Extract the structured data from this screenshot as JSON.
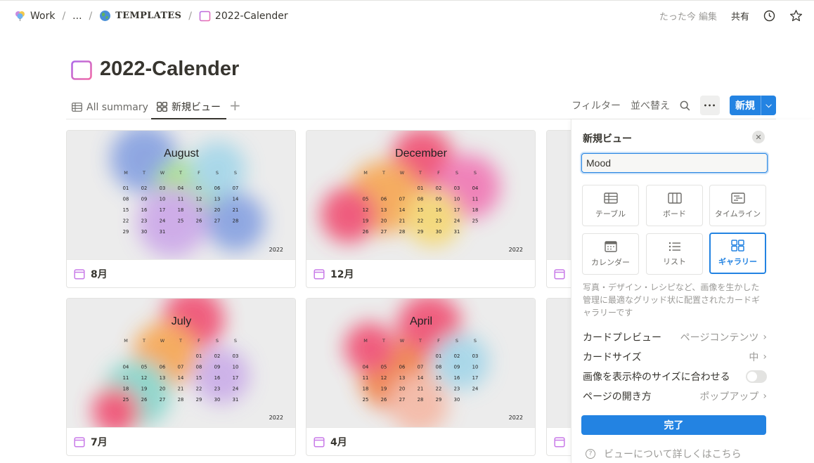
{
  "breadcrumb": {
    "workspace": "Work",
    "ellipsis": "...",
    "templates": "TEMPLATES",
    "page": "2022-Calender",
    "separator": "/"
  },
  "topbar": {
    "edited": "たった今 編集",
    "share": "共有"
  },
  "page": {
    "title": "2022-Calender"
  },
  "views": {
    "tabs": [
      {
        "label": "All summary",
        "icon": "table-icon"
      },
      {
        "label": "新規ビュー",
        "icon": "gallery-icon"
      }
    ],
    "add": "+"
  },
  "toolbar": {
    "filter": "フィルター",
    "sort": "並べ替え",
    "more": "•••",
    "new": "新規"
  },
  "gallery": {
    "weekdays": [
      "M",
      "T",
      "W",
      "T",
      "F",
      "S",
      "S"
    ],
    "cards": [
      {
        "month": "August",
        "caption": "8月",
        "year": "2022",
        "start": 0,
        "days": 31
      },
      {
        "month": "December",
        "caption": "12月",
        "year": "2022",
        "start": 3,
        "days": 31
      },
      {
        "month": "July",
        "caption": "7月",
        "year": "2022",
        "start": 4,
        "days": 31
      },
      {
        "month": "April",
        "caption": "4月",
        "year": "2022",
        "start": 4,
        "days": 30
      }
    ],
    "colors": {
      "August": [
        "#7f9be0",
        "#a6e07a",
        "#9fd4e8",
        "#c9a3e8"
      ],
      "December": [
        "#f0456a",
        "#f7a24a",
        "#f06fb0",
        "#f5d66a"
      ],
      "July": [
        "#f0456a",
        "#f7a24a",
        "#7fd4c9",
        "#c8a8e8"
      ],
      "April": [
        "#f0456a",
        "#f07a3a",
        "#9fd4e8",
        "#f5b5a0"
      ]
    }
  },
  "panel": {
    "title": "新規ビュー",
    "name_value": "Mood",
    "layouts": [
      {
        "label": "テーブル",
        "icon": "table-icon"
      },
      {
        "label": "ボード",
        "icon": "board-icon"
      },
      {
        "label": "タイムライン",
        "icon": "timeline-icon"
      },
      {
        "label": "カレンダー",
        "icon": "calendar-icon"
      },
      {
        "label": "リスト",
        "icon": "list-icon"
      },
      {
        "label": "ギャラリー",
        "icon": "gallery-icon"
      }
    ],
    "selected_layout": "ギャラリー",
    "description": "写真・デザイン・レシピなど、画像を生かした管理に最適なグリッド状に配置されたカードギャラリーです",
    "card_preview_label": "カードプレビュー",
    "card_preview_value": "ページコンテンツ",
    "card_size_label": "カードサイズ",
    "card_size_value": "中",
    "fit_image_label": "画像を表示枠のサイズに合わせる",
    "fit_image_on": false,
    "open_as_label": "ページの開き方",
    "open_as_value": "ポップアップ",
    "done": "完了",
    "help": "ビューについて詳しくはこちら"
  }
}
